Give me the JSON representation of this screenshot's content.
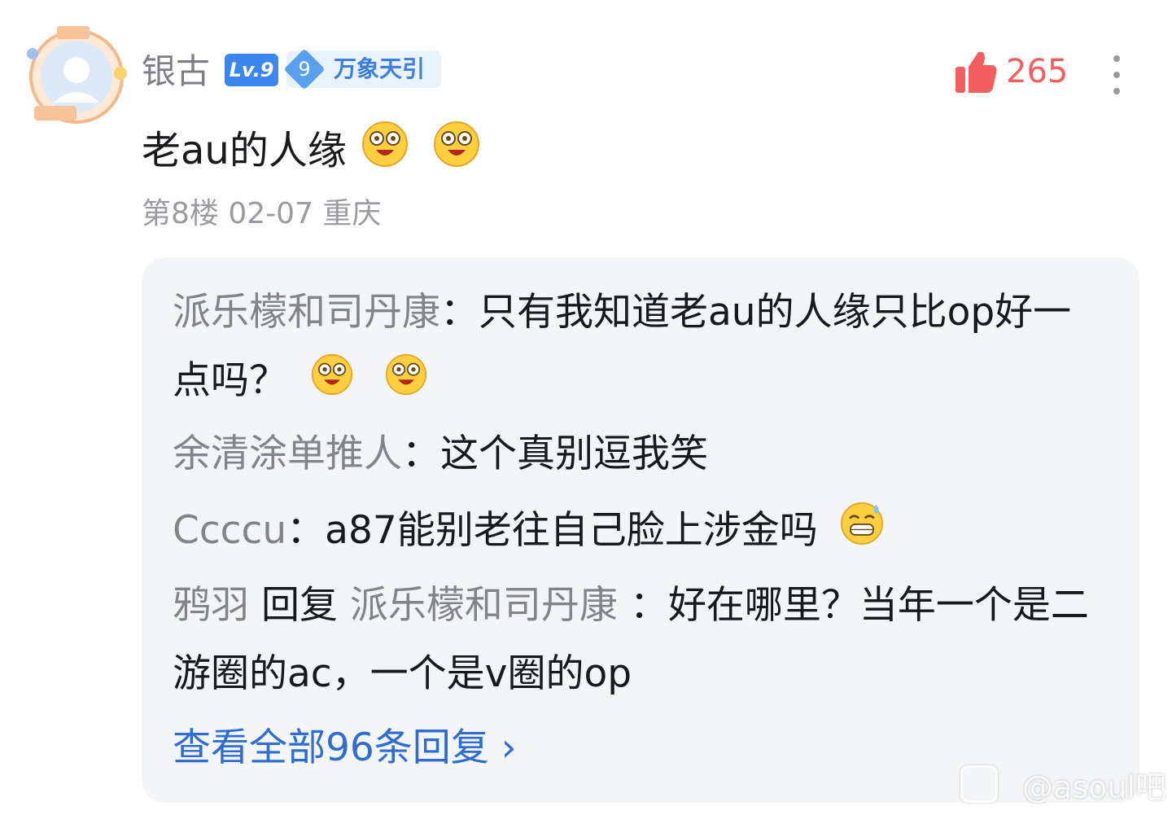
{
  "comment": {
    "username": "银古",
    "level_badge": "Lv.9",
    "fan_badge": {
      "level": "9",
      "name": "万象天引"
    },
    "likes": "265",
    "text": "老au的人缘",
    "emojis": [
      "dizzy-face-emoji",
      "dizzy-face-emoji"
    ],
    "floor": "第8楼",
    "date": "02-07",
    "location": "重庆"
  },
  "replies": [
    {
      "user": "派乐檬和司丹康",
      "sep": "：",
      "text": "只有我知道老au的人缘只比op好一点吗？",
      "emojis": [
        "dizzy-face-emoji",
        "dizzy-face-emoji"
      ]
    },
    {
      "user": "余清涂单推人",
      "sep": "：",
      "text": "这个真别逗我笑"
    },
    {
      "user": "Ccccu",
      "sep": "：",
      "text": "a87能别老往自己脸上涉金吗",
      "emojis": [
        "grin-sweat-emoji"
      ]
    },
    {
      "user": "鸦羽",
      "action": "回复",
      "target": "派乐檬和司丹康",
      "sep": "：",
      "text": "好在哪里？当年一个是二游圈的ac，一个是v圈的op"
    }
  ],
  "view_all": "查看全部96条回复 ›",
  "watermark": "@asoul吧",
  "colors": {
    "like_red": "#f25d5d",
    "link_blue": "#2f6dd0",
    "level_blue": "#3c86f0",
    "reply_bg": "#f4f5f7"
  }
}
